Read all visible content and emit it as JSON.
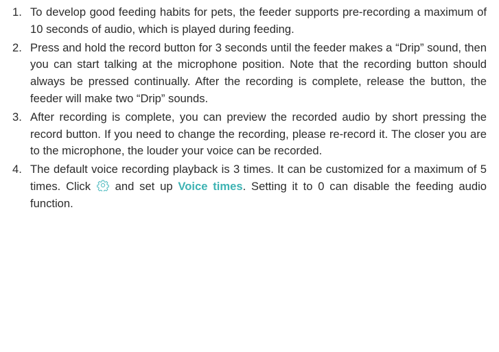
{
  "items": [
    {
      "num": "1.",
      "text": "To develop good feeding habits for pets, the feeder supports pre-recording a maximum of 10 seconds of audio, which is played during feeding."
    },
    {
      "num": "2.",
      "text": "Press and hold the record button for 3 seconds until the feeder makes a “Drip” sound, then you can start talking at the microphone position. Note that the recording button should always be pressed continually. After the recording is complete, release the button, the feeder will make two “Drip” sounds."
    },
    {
      "num": "3.",
      "text": "After recording is complete, you can preview the recorded audio by short pressing the record button. If you need to change the recording, please re-record it. The closer you are to the microphone, the louder your voice can be recorded."
    },
    {
      "num": "4.",
      "text_a": "The default voice recording playback is 3 times. It can be customized for a maximum of 5 times. Click ",
      "text_b": " and set up ",
      "highlight": "Voice times",
      "text_c": ". Setting it to 0 can disable the feeding audio function."
    }
  ],
  "icon": "settings-gear-icon",
  "colors": {
    "text": "#2b2b2b",
    "highlight": "#3db3b3",
    "icon": "#5bbfc4"
  }
}
